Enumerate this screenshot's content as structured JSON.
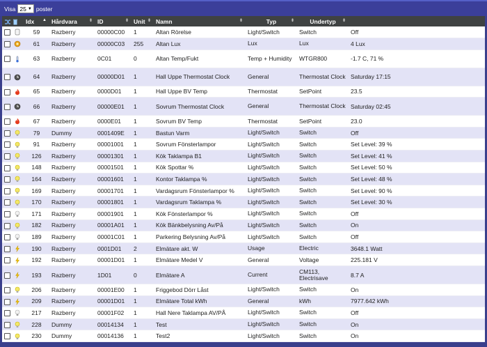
{
  "toolbar": {
    "show_label": "Visa",
    "page_size": "25",
    "posts_label": "poster"
  },
  "columns": {
    "idx": "Idx",
    "hardware": "Hårdvara",
    "id": "ID",
    "unit": "Unit",
    "name": "Namn",
    "type": "Typ",
    "subtype": "Undertyp"
  },
  "rows": [
    {
      "icon": "door-sensor-icon",
      "idx": "59",
      "hw": "Razberry",
      "id": "00000C00",
      "unit": "1",
      "name": "Altan Rörelse",
      "type": "Light/Switch",
      "sub": "Switch",
      "data": "Off"
    },
    {
      "icon": "lux-icon",
      "idx": "61",
      "hw": "Razberry",
      "id": "00000C03",
      "unit": "255",
      "name": "Altan Lux",
      "type": "Lux",
      "sub": "Lux",
      "data": "4 Lux"
    },
    {
      "icon": "thermometer-icon",
      "idx": "63",
      "hw": "Razberry",
      "id": "0C01",
      "unit": "0",
      "name": "Altan Temp/Fukt",
      "type": "Temp + Humidity",
      "sub": "WTGR800",
      "data": "-1.7 C, 71 %",
      "tall": true
    },
    {
      "icon": "clock-icon",
      "idx": "64",
      "hw": "Razberry",
      "id": "00000D01",
      "unit": "1",
      "name": "Hall Uppe Thermostat Clock",
      "type": "General",
      "sub": "Thermostat Clock",
      "data": "Saturday 17:15",
      "tall": true
    },
    {
      "icon": "flame-icon",
      "idx": "65",
      "hw": "Razberry",
      "id": "0000D01",
      "unit": "1",
      "name": "Hall Uppe BV Temp",
      "type": "Thermostat",
      "sub": "SetPoint",
      "data": "23.5"
    },
    {
      "icon": "clock-icon",
      "idx": "66",
      "hw": "Razberry",
      "id": "00000E01",
      "unit": "1",
      "name": "Sovrum Thermostat Clock",
      "type": "General",
      "sub": "Thermostat Clock",
      "data": "Saturday 02:45",
      "tall": true
    },
    {
      "icon": "flame-icon",
      "idx": "67",
      "hw": "Razberry",
      "id": "0000E01",
      "unit": "1",
      "name": "Sovrum BV Temp",
      "type": "Thermostat",
      "sub": "SetPoint",
      "data": "23.0"
    },
    {
      "icon": "bulb-icon",
      "idx": "79",
      "hw": "Dummy",
      "id": "0001409E",
      "unit": "1",
      "name": "Bastun Varm",
      "type": "Light/Switch",
      "sub": "Switch",
      "data": "Off"
    },
    {
      "icon": "bulb-icon",
      "idx": "91",
      "hw": "Razberry",
      "id": "00001001",
      "unit": "1",
      "name": "Sovrum Fönsterlampor",
      "type": "Light/Switch",
      "sub": "Switch",
      "data": "Set Level: 39 %"
    },
    {
      "icon": "bulb-icon",
      "idx": "126",
      "hw": "Razberry",
      "id": "00001301",
      "unit": "1",
      "name": "Kök Taklampa B1",
      "type": "Light/Switch",
      "sub": "Switch",
      "data": "Set Level: 41 %"
    },
    {
      "icon": "bulb-icon",
      "idx": "148",
      "hw": "Razberry",
      "id": "00001501",
      "unit": "1",
      "name": "Kök Spottar %",
      "type": "Light/Switch",
      "sub": "Switch",
      "data": "Set Level: 50 %"
    },
    {
      "icon": "bulb-icon",
      "idx": "164",
      "hw": "Razberry",
      "id": "00001601",
      "unit": "1",
      "name": "Kontor Taklampa %",
      "type": "Light/Switch",
      "sub": "Switch",
      "data": "Set Level: 48 %"
    },
    {
      "icon": "bulb-icon",
      "idx": "169",
      "hw": "Razberry",
      "id": "00001701",
      "unit": "1",
      "name": "Vardagsrum Fönsterlampor %",
      "type": "Light/Switch",
      "sub": "Switch",
      "data": "Set Level: 90 %"
    },
    {
      "icon": "bulb-icon",
      "idx": "170",
      "hw": "Razberry",
      "id": "00001801",
      "unit": "1",
      "name": "Vardagsrum Taklampa %",
      "type": "Light/Switch",
      "sub": "Switch",
      "data": "Set Level: 30 %"
    },
    {
      "icon": "bulb-off-icon",
      "idx": "171",
      "hw": "Razberry",
      "id": "00001901",
      "unit": "1",
      "name": "Kök Fönsterlampor %",
      "type": "Light/Switch",
      "sub": "Switch",
      "data": "Off"
    },
    {
      "icon": "bulb-icon",
      "idx": "182",
      "hw": "Razberry",
      "id": "00001A01",
      "unit": "1",
      "name": "Kök Bänkbelysning Av/På",
      "type": "Light/Switch",
      "sub": "Switch",
      "data": "On"
    },
    {
      "icon": "bulb-off-icon",
      "idx": "189",
      "hw": "Razberry",
      "id": "00001C01",
      "unit": "1",
      "name": "Parkering Belysning Av/På",
      "type": "Light/Switch",
      "sub": "Switch",
      "data": "Off"
    },
    {
      "icon": "meter-icon",
      "idx": "190",
      "hw": "Razberry",
      "id": "0001D01",
      "unit": "2",
      "name": "Elmätare akt. W",
      "type": "Usage",
      "sub": "Electric",
      "data": "3648.1 Watt"
    },
    {
      "icon": "meter-icon",
      "idx": "192",
      "hw": "Razberry",
      "id": "00001D01",
      "unit": "1",
      "name": "Elmätare Medel V",
      "type": "General",
      "sub": "Voltage",
      "data": "225.181 V"
    },
    {
      "icon": "meter-icon",
      "idx": "193",
      "hw": "Razberry",
      "id": "1D01",
      "unit": "0",
      "name": "Elmätare A",
      "type": "Current",
      "sub": "CM113, Electrisave",
      "data": "8.7 A",
      "tall": true
    },
    {
      "icon": "bulb-icon",
      "idx": "206",
      "hw": "Razberry",
      "id": "00001E00",
      "unit": "1",
      "name": "Friggebod Dörr Låst",
      "type": "Light/Switch",
      "sub": "Switch",
      "data": "On"
    },
    {
      "icon": "meter-icon",
      "idx": "209",
      "hw": "Razberry",
      "id": "00001D01",
      "unit": "1",
      "name": "Elmätare Total kWh",
      "type": "General",
      "sub": "kWh",
      "data": "7977.642 kWh"
    },
    {
      "icon": "bulb-off-icon",
      "idx": "217",
      "hw": "Razberry",
      "id": "00001F02",
      "unit": "1",
      "name": "Hall Nere Taklampa AV/PÅ",
      "type": "Light/Switch",
      "sub": "Switch",
      "data": "Off"
    },
    {
      "icon": "bulb-icon",
      "idx": "228",
      "hw": "Dummy",
      "id": "00014134",
      "unit": "1",
      "name": "Test",
      "type": "Light/Switch",
      "sub": "Switch",
      "data": "On"
    },
    {
      "icon": "bulb-icon",
      "idx": "230",
      "hw": "Dummy",
      "id": "00014136",
      "unit": "1",
      "name": "Test2",
      "type": "Light/Switch",
      "sub": "Switch",
      "data": "On"
    }
  ]
}
